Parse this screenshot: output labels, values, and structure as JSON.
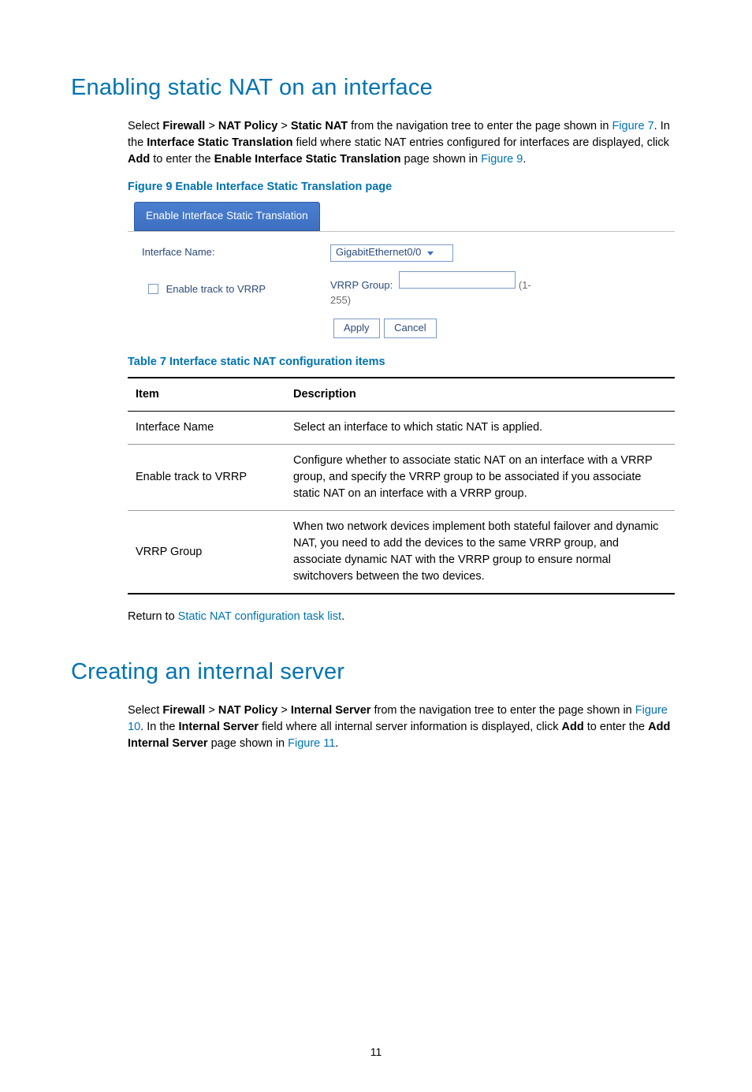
{
  "section1": {
    "heading": "Enabling static NAT on an interface",
    "para_parts": {
      "p1a": "Select ",
      "bold1": "Firewall",
      "gt1": " > ",
      "bold2": "NAT Policy",
      "gt2": " > ",
      "bold3": "Static NAT",
      "p1b": " from the navigation tree to enter the page shown in ",
      "link1": "Figure 7",
      "p1c": ". In the ",
      "bold4": "Interface Static Translation",
      "p1d": " field where static NAT entries configured for interfaces are displayed, click ",
      "bold5": "Add",
      "p1e": " to enter the ",
      "bold6": "Enable Interface Static Translation",
      "p1f": " page shown in ",
      "link2": "Figure 9",
      "p1g": "."
    },
    "figure_caption": "Figure 9 Enable Interface Static Translation page",
    "figure": {
      "tab": "Enable Interface Static Translation",
      "iface_label": "Interface Name:",
      "iface_value": "GigabitEthernet0/0",
      "track_label": "Enable track to VRRP",
      "vrrp_label": "VRRP Group:",
      "range": "(1-255)",
      "apply": "Apply",
      "cancel": "Cancel"
    },
    "table_caption": "Table 7 Interface static NAT configuration items",
    "table": {
      "head_item": "Item",
      "head_desc": "Description",
      "rows": [
        {
          "item": "Interface Name",
          "desc": "Select an interface to which static NAT is applied."
        },
        {
          "item": "Enable track to VRRP",
          "desc": "Configure whether to associate static NAT on an interface with a VRRP group, and specify the VRRP group to be associated if you associate static NAT on an interface with a VRRP group."
        },
        {
          "item": "VRRP Group",
          "desc": "When two network devices implement both stateful failover and dynamic NAT, you need to add the devices to the same VRRP group, and associate dynamic NAT with the VRRP group to ensure normal switchovers between the two devices."
        }
      ]
    },
    "return_text_a": "Return to ",
    "return_link": "Static NAT configuration task list",
    "return_text_b": "."
  },
  "section2": {
    "heading": "Creating an internal server",
    "para_parts": {
      "p1a": "Select ",
      "bold1": "Firewall",
      "gt1": " > ",
      "bold2": "NAT Policy",
      "gt2": " > ",
      "bold3": "Internal Server",
      "p1b": " from the navigation tree to enter the page shown in ",
      "link1": "Figure 10",
      "p1c": ". In the ",
      "bold4": "Internal Server",
      "p1d": " field where all internal server information is displayed, click ",
      "bold5": "Add",
      "p1e": " to enter the ",
      "bold6": "Add Internal Server",
      "p1f": " page shown in ",
      "link2": "Figure 11",
      "p1g": "."
    }
  },
  "page_number": "11"
}
